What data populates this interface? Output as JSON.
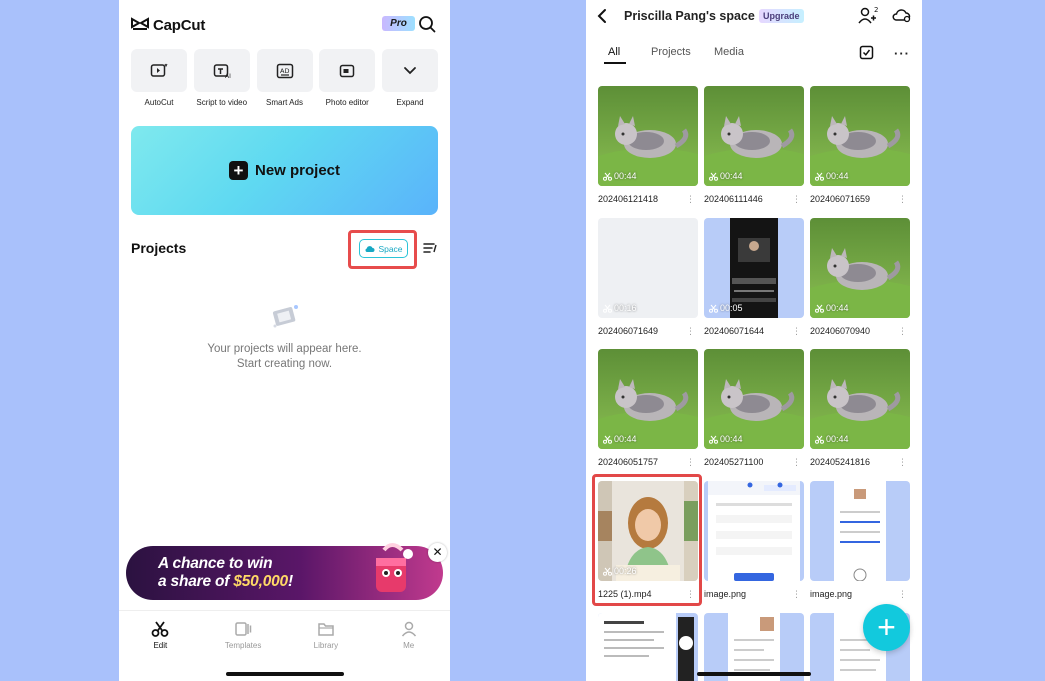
{
  "left": {
    "brand": "CapCut",
    "pro_badge": "Pro",
    "tools": [
      {
        "label": "AutoCut",
        "icon": "autocut-icon"
      },
      {
        "label": "Script to video",
        "icon": "script-to-video-icon"
      },
      {
        "label": "Smart Ads",
        "icon": "smart-ads-icon"
      },
      {
        "label": "Photo editor",
        "icon": "photo-editor-icon"
      },
      {
        "label": "Expand",
        "icon": "chevron-down-icon"
      }
    ],
    "new_project": "New project",
    "projects_title": "Projects",
    "space_label": "Space",
    "empty_line1": "Your projects will appear here.",
    "empty_line2": "Start creating now.",
    "promo": {
      "line1": "A chance to win",
      "line2_pre": "a share of ",
      "line2_amount": "$50,000",
      "line2_post": "!",
      "close": "✕"
    },
    "nav": [
      {
        "label": "Edit",
        "active": true
      },
      {
        "label": "Templates",
        "active": false
      },
      {
        "label": "Library",
        "active": false
      },
      {
        "label": "Me",
        "active": false
      }
    ]
  },
  "right": {
    "title": "Priscilla Pang's space",
    "upgrade": "Upgrade",
    "collab_count": "2",
    "tabs": [
      {
        "label": "All",
        "active": true
      },
      {
        "label": "Projects",
        "active": false
      },
      {
        "label": "Media",
        "active": false
      }
    ],
    "items": [
      {
        "name": "202406121418",
        "duration": "00:44",
        "kind": "cat"
      },
      {
        "name": "202406111446",
        "duration": "00:44",
        "kind": "cat"
      },
      {
        "name": "202406071659",
        "duration": "00:44",
        "kind": "cat"
      },
      {
        "name": "202406071649",
        "duration": "00:16",
        "kind": "blank"
      },
      {
        "name": "202406071644",
        "duration": "00:05",
        "kind": "phone-dark"
      },
      {
        "name": "202406070940",
        "duration": "00:44",
        "kind": "cat"
      },
      {
        "name": "202406051757",
        "duration": "00:44",
        "kind": "cat"
      },
      {
        "name": "202405271100",
        "duration": "00:44",
        "kind": "cat"
      },
      {
        "name": "202405241816",
        "duration": "00:44",
        "kind": "cat"
      },
      {
        "name": "1225 (1).mp4",
        "duration": "00:26",
        "kind": "girl"
      },
      {
        "name": "image.png",
        "duration": "",
        "kind": "screen-form"
      },
      {
        "name": "image.png",
        "duration": "",
        "kind": "screen-settings"
      },
      {
        "name": "",
        "duration": "",
        "kind": "screen-list"
      },
      {
        "name": "",
        "duration": "",
        "kind": "screen-profile"
      },
      {
        "name": "",
        "duration": "",
        "kind": "screen-profile2"
      }
    ],
    "fab": "+"
  },
  "colors": {
    "accent": "#12c9dd",
    "highlight_box": "#e24848",
    "background": "#a9c1fb"
  }
}
